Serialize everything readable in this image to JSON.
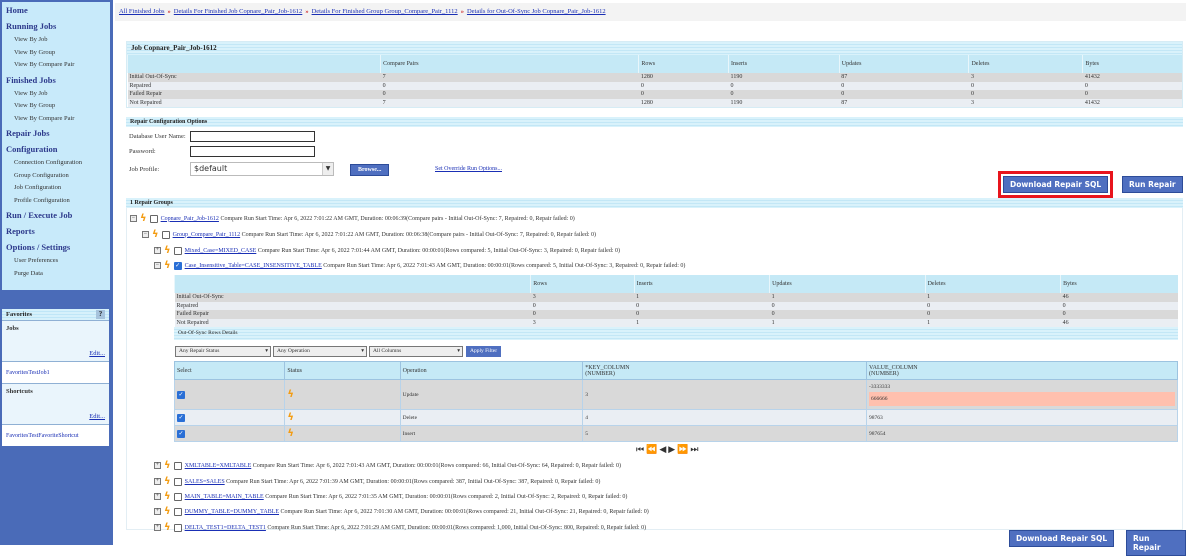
{
  "sidebar": {
    "sections": [
      {
        "title": "Home",
        "items": []
      },
      {
        "title": "Running Jobs",
        "items": [
          "View By Job",
          "View By Group",
          "View By Compare Pair"
        ]
      },
      {
        "title": "Finished Jobs",
        "items": [
          "View By Job",
          "View By Group",
          "View By Compare Pair"
        ]
      },
      {
        "title": "Repair Jobs",
        "items": []
      },
      {
        "title": "Configuration",
        "items": [
          "Connection Configuration",
          "Group Configuration",
          "Job Configuration",
          "Profile Configuration"
        ]
      },
      {
        "title": "Run / Execute Job",
        "items": []
      },
      {
        "title": "Reports",
        "items": []
      },
      {
        "title": "Options / Settings",
        "items": [
          "User Preferences",
          "Purge Data"
        ]
      }
    ],
    "favorites": {
      "title": "Favorites",
      "help": "?",
      "jobs_label": "Jobs",
      "edit1": "Edit...",
      "job_link": "FavoritesTestJob1",
      "shortcuts_label": "Shortcuts",
      "edit2": "Edit...",
      "shortcut_link": "FavoritesTestFavoriteShortcut"
    }
  },
  "breadcrumb": [
    "All Finished Jobs",
    "Details For Finished Job Copnare_Pair_Job-1612",
    "Details For Finished Group Group_Compare_Pair_1112",
    "Details for Out-Of-Sync Job Copnare_Pair_Job-1612"
  ],
  "breadcrumb_sep": "»",
  "job": {
    "title": "Job Copnare_Pair_Job-1612",
    "columns": [
      "",
      "Compare Pairs",
      "Rows",
      "Inserts",
      "Updates",
      "Deletes",
      "Bytes"
    ],
    "rows": [
      [
        "Initial Out-Of-Sync",
        "7",
        "1280",
        "1190",
        "87",
        "3",
        "41432"
      ],
      [
        "Repaired",
        "0",
        "0",
        "0",
        "0",
        "0",
        "0"
      ],
      [
        "Failed Repair",
        "0",
        "0",
        "0",
        "0",
        "0",
        "0"
      ],
      [
        "Not Repaired",
        "7",
        "1280",
        "1190",
        "87",
        "3",
        "41432"
      ]
    ]
  },
  "config": {
    "title": "Repair Configuration Options",
    "user_label": "Database User Name:",
    "user_value": "",
    "password_label": "Password:",
    "password_value": "",
    "profile_label": "Job Profile:",
    "profile_value": "$default",
    "browse": "Browse...",
    "override": "Set Override Run Options...",
    "download": "Download Repair SQL",
    "run": "Run Repair"
  },
  "groups": {
    "title": "1 Repair Groups",
    "job": {
      "link": "Copnare_Pair_Job-1612",
      "text": "Compare Run Start Time: Apr 6, 2022 7:01:22 AM GMT, Duration: 00:06:39(Compare pairs - Initial Out-Of-Sync: 7, Repaired: 0, Repair failed: 0)"
    },
    "group": {
      "link": "Group_Compare_Pair_1112",
      "text": "Compare Run Start Time: Apr 6, 2022 7:01:22 AM GMT, Duration: 00:06:38(Compare pairs - Initial Out-Of-Sync: 7, Repaired: 0, Repair failed: 0)"
    },
    "pairs": [
      {
        "link": "Mixed_Case=MIXED_CASE",
        "text": "Compare Run Start Time: Apr 6, 2022 7:01:44 AM GMT, Duration: 00:00:01(Rows compared: 5, Initial Out-Of-Sync: 3, Repaired: 0, Repair failed: 0)"
      },
      {
        "link": "Case_Insensitive_Table=CASE_INSENSITIVE_TABLE",
        "text": "Compare Run Start Time: Apr 6, 2022 7:01:43 AM GMT, Duration: 00:00:01(Rows compared: 5, Initial Out-Of-Sync: 3, Repaired: 0, Repair failed: 0)"
      },
      {
        "link": "XMLTABLE=XMLTABLE",
        "text": "Compare Run Start Time: Apr 6, 2022 7:01:43 AM GMT, Duration: 00:00:01(Rows compared: 66, Initial Out-Of-Sync: 64, Repaired: 0, Repair failed: 0)"
      },
      {
        "link": "SALES=SALES",
        "text": "Compare Run Start Time: Apr 6, 2022 7:01:39 AM GMT, Duration: 00:00:01(Rows compared: 387, Initial Out-Of-Sync: 387, Repaired: 0, Repair failed: 0)"
      },
      {
        "link": "MAIN_TABLE=MAIN_TABLE",
        "text": "Compare Run Start Time: Apr 6, 2022 7:01:35 AM GMT, Duration: 00:00:01(Rows compared: 2, Initial Out-Of-Sync: 2, Repaired: 0, Repair failed: 0)"
      },
      {
        "link": "DUMMY_TABLE=DUMMY_TABLE",
        "text": "Compare Run Start Time: Apr 6, 2022 7:01:30 AM GMT, Duration: 00:00:01(Rows compared: 21, Initial Out-Of-Sync: 21, Repaired: 0, Repair failed: 0)"
      },
      {
        "link": "DELTA_TEST1=DELTA_TEST1",
        "text": "Compare Run Start Time: Apr 6, 2022 7:01:29 AM GMT, Duration: 00:00:01(Rows compared: 1,000, Initial Out-Of-Sync: 800, Repaired: 0, Repair failed: 0)"
      }
    ]
  },
  "pair_stats": {
    "columns": [
      "",
      "Rows",
      "Inserts",
      "Updates",
      "Deletes",
      "Bytes"
    ],
    "rows": [
      [
        "Initial Out-Of-Sync",
        "3",
        "1",
        "1",
        "1",
        "46"
      ],
      [
        "Repaired",
        "0",
        "0",
        "0",
        "0",
        "0"
      ],
      [
        "Failed Repair",
        "0",
        "0",
        "0",
        "0",
        "0"
      ],
      [
        "Not Repaired",
        "3",
        "1",
        "1",
        "1",
        "46"
      ]
    ]
  },
  "details": {
    "title": "Out-Of-Sync Rows Details",
    "filters": [
      "Any Repair Status",
      "Any Operation",
      "All Columns"
    ],
    "apply": "Apply Filter",
    "columns": [
      "Select",
      "Status",
      "Operation",
      "*KEY_COLUMN\n(NUMBER)",
      "VALUE_COLUMN\n(NUMBER)"
    ],
    "rows": [
      {
        "op": "Update",
        "key": "3",
        "value": "-3333333",
        "new_value": "666666"
      },
      {
        "op": "Delete",
        "key": "4",
        "value": "98763"
      },
      {
        "op": "Insert",
        "key": "5",
        "value": "987654"
      }
    ],
    "pager": [
      "⏮",
      "⏪",
      "◀",
      "▶",
      "⏩",
      "⏭"
    ]
  }
}
